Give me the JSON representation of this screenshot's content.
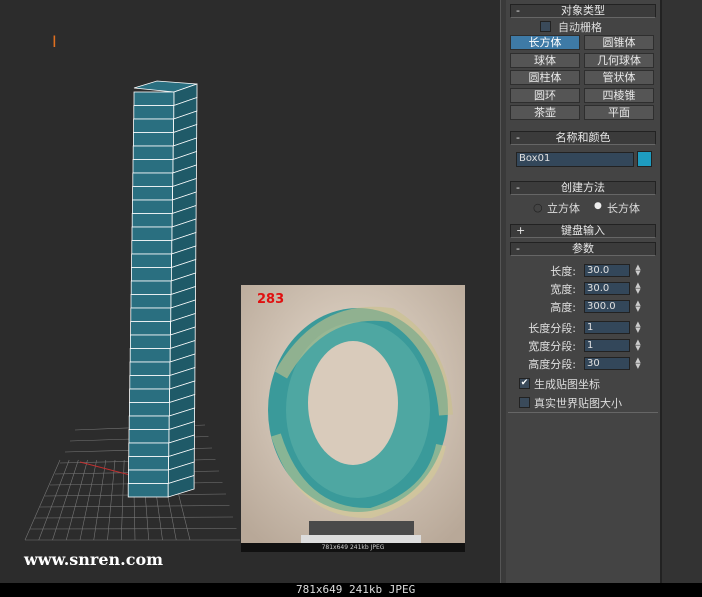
{
  "viewport": {
    "watermark": "www.snren.com",
    "cursor_mark": "I",
    "object_color": "#2a6f80"
  },
  "photo": {
    "number": "283",
    "caption": "781x649  241kb  JPEG"
  },
  "panel": {
    "object_type": {
      "sign": "-",
      "title": "对象类型",
      "autogrid": "自动栅格",
      "buttons": [
        "长方体",
        "圆锥体",
        "球体",
        "几何球体",
        "圆柱体",
        "管状体",
        "圆环",
        "四棱锥",
        "茶壶",
        "平面"
      ]
    },
    "name_color": {
      "sign": "-",
      "title": "名称和颜色",
      "name": "Box01",
      "color": "#1e9cc0"
    },
    "creation": {
      "sign": "-",
      "title": "创建方法",
      "options": [
        "立方体",
        "长方体"
      ],
      "selected": "长方体"
    },
    "keyboard": {
      "sign": "+",
      "title": "键盘输入"
    },
    "params": {
      "sign": "-",
      "title": "参数",
      "fields": [
        {
          "label": "长度:",
          "value": "30.0"
        },
        {
          "label": "宽度:",
          "value": "30.0"
        },
        {
          "label": "高度:",
          "value": "300.0"
        },
        {
          "label": "长度分段:",
          "value": "1"
        },
        {
          "label": "宽度分段:",
          "value": "1"
        },
        {
          "label": "高度分段:",
          "value": "30"
        }
      ],
      "gen_mapping": "生成贴图坐标",
      "gen_mapping_checked": true,
      "real_world": "真实世界贴图大小",
      "real_world_checked": false
    }
  },
  "status": {
    "text": "781x649  241kb  JPEG"
  }
}
